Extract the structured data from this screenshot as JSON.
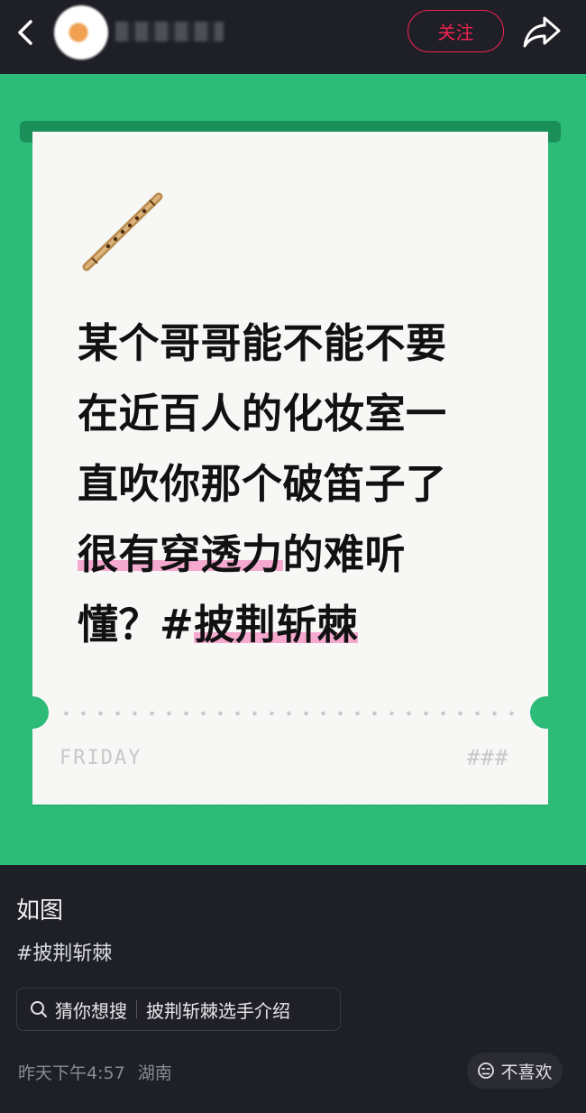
{
  "header": {
    "follow_label": "关注",
    "icons": {
      "back": "back-arrow-icon",
      "share": "share-arrow-icon"
    }
  },
  "card": {
    "lines": [
      {
        "text": "某个哥哥能不能不要"
      },
      {
        "text": "在近百人的化妆室一"
      },
      {
        "text": "直吹你那个破笛子了"
      },
      {
        "pre": "",
        "highlight": "很有穿透力",
        "post": "的难听"
      },
      {
        "pre": "懂？#",
        "highlight": "披荆斩棘",
        "post": ""
      }
    ],
    "footer_day": "FRIDAY",
    "footer_mark": "###",
    "icon": "flute-icon"
  },
  "post": {
    "caption": "如图",
    "hashtag": "#披荆斩棘",
    "search_suggestion": {
      "label": "猜你想搜",
      "query": "披荆斩棘选手介绍"
    },
    "timestamp": "昨天下午4:57",
    "location": "湖南",
    "dislike_label": "不喜欢"
  },
  "colors": {
    "background": "#1f1f27",
    "accent": "#f2234f",
    "card_green": "#2dbb78",
    "highlight": "#f5a9cf"
  }
}
